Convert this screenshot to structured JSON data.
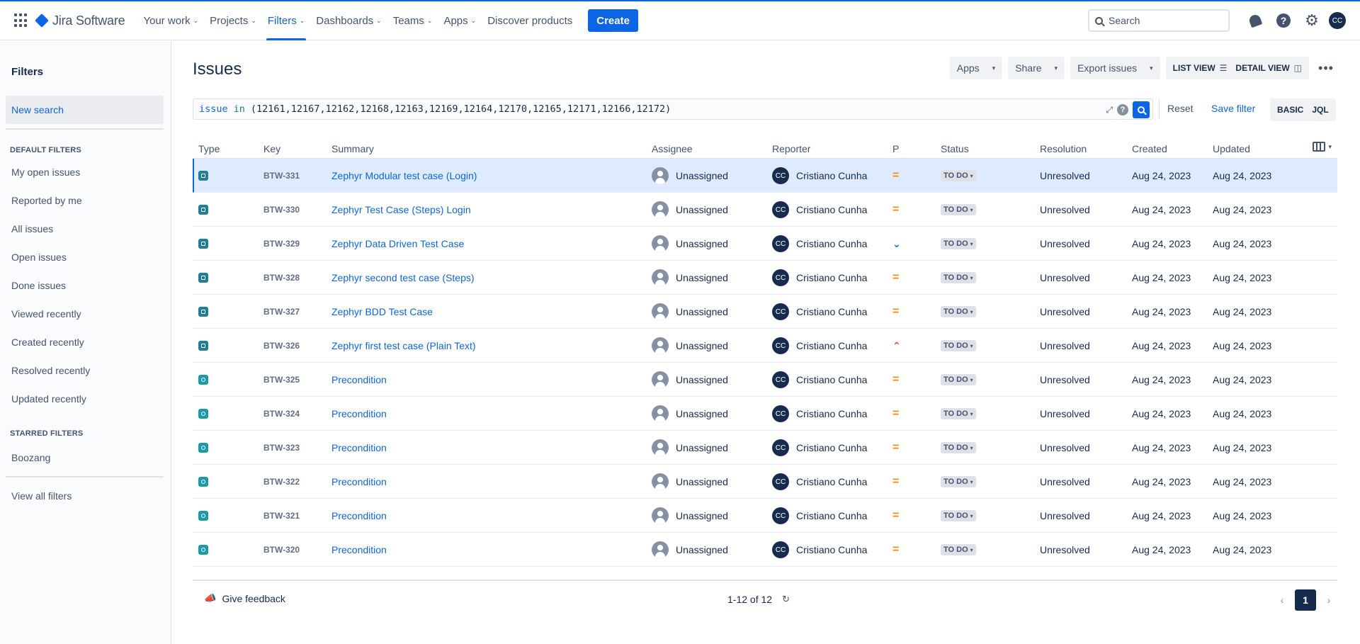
{
  "nav": {
    "product": "Jira Software",
    "items": [
      {
        "label": "Your work",
        "chevron": true
      },
      {
        "label": "Projects",
        "chevron": true
      },
      {
        "label": "Filters",
        "chevron": true,
        "active": true
      },
      {
        "label": "Dashboards",
        "chevron": true
      },
      {
        "label": "Teams",
        "chevron": true
      },
      {
        "label": "Apps",
        "chevron": true
      },
      {
        "label": "Discover products",
        "chevron": false
      }
    ],
    "create_label": "Create",
    "search_placeholder": "Search",
    "user_initials": "CC"
  },
  "sidebar": {
    "title": "Filters",
    "new_search": "New search",
    "default_heading": "DEFAULT FILTERS",
    "default_items": [
      "My open issues",
      "Reported by me",
      "All issues",
      "Open issues",
      "Done issues",
      "Viewed recently",
      "Created recently",
      "Resolved recently",
      "Updated recently"
    ],
    "starred_heading": "STARRED FILTERS",
    "starred_items": [
      "Boozang"
    ],
    "view_all": "View all filters"
  },
  "main": {
    "title": "Issues",
    "actions": {
      "apps": "Apps",
      "share": "Share",
      "export": "Export issues",
      "list_view": "LIST VIEW",
      "detail_view": "DETAIL VIEW"
    },
    "jql": {
      "keyword": "issue",
      "operator": "in",
      "value": "(12161,12167,12162,12168,12163,12169,12164,12170,12165,12171,12166,12172)"
    },
    "reset": "Reset",
    "save_filter": "Save filter",
    "mode_basic": "BASIC",
    "mode_jql": "JQL",
    "columns": [
      "Type",
      "Key",
      "Summary",
      "Assignee",
      "Reporter",
      "P",
      "Status",
      "Resolution",
      "Created",
      "Updated"
    ],
    "rows": [
      {
        "type": "test",
        "key": "BTW-331",
        "summary": "Zephyr Modular test case (Login)",
        "assignee": "Unassigned",
        "reporter": "Cristiano Cunha",
        "reporter_initials": "CC",
        "priority": "medium",
        "status": "TO DO",
        "resolution": "Unresolved",
        "created": "Aug 24, 2023",
        "updated": "Aug 24, 2023",
        "selected": true
      },
      {
        "type": "test",
        "key": "BTW-330",
        "summary": "Zephyr Test Case (Steps) Login",
        "assignee": "Unassigned",
        "reporter": "Cristiano Cunha",
        "reporter_initials": "CC",
        "priority": "medium",
        "status": "TO DO",
        "resolution": "Unresolved",
        "created": "Aug 24, 2023",
        "updated": "Aug 24, 2023"
      },
      {
        "type": "test",
        "key": "BTW-329",
        "summary": "Zephyr Data Driven Test Case",
        "assignee": "Unassigned",
        "reporter": "Cristiano Cunha",
        "reporter_initials": "CC",
        "priority": "low",
        "status": "TO DO",
        "resolution": "Unresolved",
        "created": "Aug 24, 2023",
        "updated": "Aug 24, 2023"
      },
      {
        "type": "test",
        "key": "BTW-328",
        "summary": "Zephyr second test case (Steps)",
        "assignee": "Unassigned",
        "reporter": "Cristiano Cunha",
        "reporter_initials": "CC",
        "priority": "medium",
        "status": "TO DO",
        "resolution": "Unresolved",
        "created": "Aug 24, 2023",
        "updated": "Aug 24, 2023"
      },
      {
        "type": "test",
        "key": "BTW-327",
        "summary": "Zephyr BDD Test Case",
        "assignee": "Unassigned",
        "reporter": "Cristiano Cunha",
        "reporter_initials": "CC",
        "priority": "medium",
        "status": "TO DO",
        "resolution": "Unresolved",
        "created": "Aug 24, 2023",
        "updated": "Aug 24, 2023"
      },
      {
        "type": "test",
        "key": "BTW-326",
        "summary": "Zephyr first test case (Plain Text)",
        "assignee": "Unassigned",
        "reporter": "Cristiano Cunha",
        "reporter_initials": "CC",
        "priority": "high",
        "status": "TO DO",
        "resolution": "Unresolved",
        "created": "Aug 24, 2023",
        "updated": "Aug 24, 2023"
      },
      {
        "type": "precondition",
        "key": "BTW-325",
        "summary": "Precondition",
        "assignee": "Unassigned",
        "reporter": "Cristiano Cunha",
        "reporter_initials": "CC",
        "priority": "medium",
        "status": "TO DO",
        "resolution": "Unresolved",
        "created": "Aug 24, 2023",
        "updated": "Aug 24, 2023"
      },
      {
        "type": "precondition",
        "key": "BTW-324",
        "summary": "Precondition",
        "assignee": "Unassigned",
        "reporter": "Cristiano Cunha",
        "reporter_initials": "CC",
        "priority": "medium",
        "status": "TO DO",
        "resolution": "Unresolved",
        "created": "Aug 24, 2023",
        "updated": "Aug 24, 2023"
      },
      {
        "type": "precondition",
        "key": "BTW-323",
        "summary": "Precondition",
        "assignee": "Unassigned",
        "reporter": "Cristiano Cunha",
        "reporter_initials": "CC",
        "priority": "medium",
        "status": "TO DO",
        "resolution": "Unresolved",
        "created": "Aug 24, 2023",
        "updated": "Aug 24, 2023"
      },
      {
        "type": "precondition",
        "key": "BTW-322",
        "summary": "Precondition",
        "assignee": "Unassigned",
        "reporter": "Cristiano Cunha",
        "reporter_initials": "CC",
        "priority": "medium",
        "status": "TO DO",
        "resolution": "Unresolved",
        "created": "Aug 24, 2023",
        "updated": "Aug 24, 2023"
      },
      {
        "type": "precondition",
        "key": "BTW-321",
        "summary": "Precondition",
        "assignee": "Unassigned",
        "reporter": "Cristiano Cunha",
        "reporter_initials": "CC",
        "priority": "medium",
        "status": "TO DO",
        "resolution": "Unresolved",
        "created": "Aug 24, 2023",
        "updated": "Aug 24, 2023"
      },
      {
        "type": "precondition",
        "key": "BTW-320",
        "summary": "Precondition",
        "assignee": "Unassigned",
        "reporter": "Cristiano Cunha",
        "reporter_initials": "CC",
        "priority": "medium",
        "status": "TO DO",
        "resolution": "Unresolved",
        "created": "Aug 24, 2023",
        "updated": "Aug 24, 2023"
      }
    ],
    "footer": {
      "feedback": "Give feedback",
      "count": "1-12 of 12",
      "page": "1"
    }
  },
  "colors": {
    "accent": "#0c66e4",
    "selected_row": "#deebff",
    "priority_medium": "#f18d13",
    "priority_low": "#0c66e4",
    "priority_high": "#e34935"
  }
}
